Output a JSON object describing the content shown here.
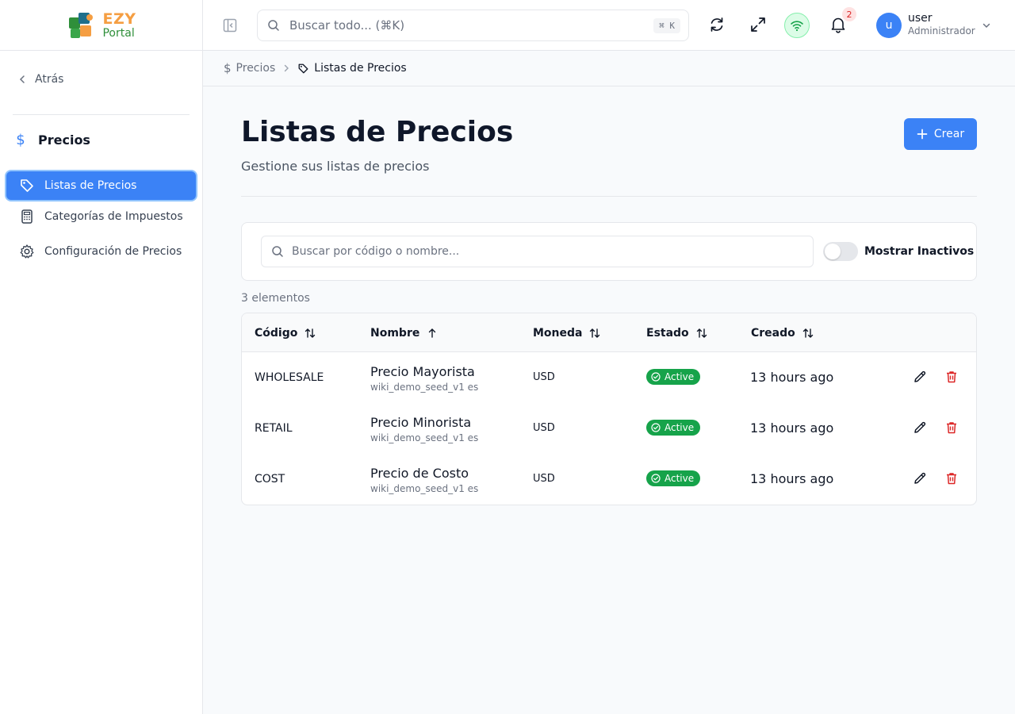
{
  "brand": {
    "name_top": "EZY",
    "name_bottom": "Portal"
  },
  "sidebar": {
    "back_label": "Atrás",
    "section_title": "Precios",
    "items": [
      {
        "label": "Listas de Precios",
        "icon": "tag-icon",
        "active": true
      },
      {
        "label": "Categorías de Impuestos",
        "icon": "calculator-icon",
        "active": false
      },
      {
        "label": "Configuración de Precios",
        "icon": "gear-icon",
        "active": false
      }
    ]
  },
  "topbar": {
    "search_placeholder": "Buscar todo... (⌘K)",
    "search_shortcut": "⌘ K",
    "notification_count": "2",
    "user_initial": "u",
    "user_name": "user",
    "user_role": "Administrador"
  },
  "breadcrumb": {
    "parent": "Precios",
    "current": "Listas de Precios"
  },
  "main": {
    "title": "Listas de Precios",
    "subtitle": "Gestione sus listas de precios",
    "create_label": "Crear",
    "search_placeholder": "Buscar por código o nombre...",
    "show_inactive_label": "Mostrar Inactivos",
    "show_inactive": false,
    "item_count": "3 elementos"
  },
  "table": {
    "columns": [
      "Código",
      "Nombre",
      "Moneda",
      "Estado",
      "Creado"
    ],
    "rows": [
      {
        "code": "WHOLESALE",
        "name": "Precio Mayorista",
        "sub": "wiki_demo_seed_v1 es",
        "currency": "USD",
        "status": "Active",
        "created": "13 hours ago"
      },
      {
        "code": "RETAIL",
        "name": "Precio Minorista",
        "sub": "wiki_demo_seed_v1 es",
        "currency": "USD",
        "status": "Active",
        "created": "13 hours ago"
      },
      {
        "code": "COST",
        "name": "Precio de Costo",
        "sub": "wiki_demo_seed_v1 es",
        "currency": "USD",
        "status": "Active",
        "created": "13 hours ago"
      }
    ]
  },
  "colors": {
    "primary": "#3b82f6",
    "success": "#16a34a",
    "danger": "#dc2626",
    "brand_orange": "#f59e42",
    "brand_green": "#2f8f3a"
  }
}
